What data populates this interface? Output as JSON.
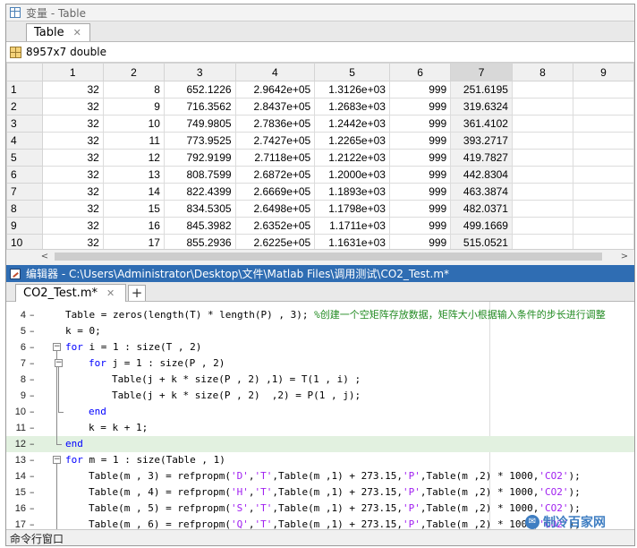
{
  "variables_window": {
    "title": "变量 - Table",
    "tab_label": "Table",
    "close_glyph": "✕",
    "info": "8957x7 double",
    "icons": {
      "window": "variable-window-icon",
      "array": "array-grid-icon"
    }
  },
  "table": {
    "column_headers": [
      "1",
      "2",
      "3",
      "4",
      "5",
      "6",
      "7",
      "8",
      "9"
    ],
    "selected_column": "7",
    "rows": [
      [
        "1",
        "32",
        "8",
        "652.1226",
        "2.9642e+05",
        "1.3126e+03",
        "999",
        "251.6195",
        "",
        ""
      ],
      [
        "2",
        "32",
        "9",
        "716.3562",
        "2.8437e+05",
        "1.2683e+03",
        "999",
        "319.6324",
        "",
        ""
      ],
      [
        "3",
        "32",
        "10",
        "749.9805",
        "2.7836e+05",
        "1.2442e+03",
        "999",
        "361.4102",
        "",
        ""
      ],
      [
        "4",
        "32",
        "11",
        "773.9525",
        "2.7427e+05",
        "1.2265e+03",
        "999",
        "393.2717",
        "",
        ""
      ],
      [
        "5",
        "32",
        "12",
        "792.9199",
        "2.7118e+05",
        "1.2122e+03",
        "999",
        "419.7827",
        "",
        ""
      ],
      [
        "6",
        "32",
        "13",
        "808.7599",
        "2.6872e+05",
        "1.2000e+03",
        "999",
        "442.8304",
        "",
        ""
      ],
      [
        "7",
        "32",
        "14",
        "822.4399",
        "2.6669e+05",
        "1.1893e+03",
        "999",
        "463.3874",
        "",
        ""
      ],
      [
        "8",
        "32",
        "15",
        "834.5305",
        "2.6498e+05",
        "1.1798e+03",
        "999",
        "482.0371",
        "",
        ""
      ],
      [
        "9",
        "32",
        "16",
        "845.3982",
        "2.6352e+05",
        "1.1711e+03",
        "999",
        "499.1669",
        "",
        ""
      ],
      [
        "10",
        "32",
        "17",
        "855.2936",
        "2.6225e+05",
        "1.1631e+03",
        "999",
        "515.0521",
        "",
        ""
      ]
    ],
    "scroll_left": "<",
    "scroll_right": ">"
  },
  "editor_window": {
    "title": "编辑器 - C:\\Users\\Administrator\\Desktop\\文件\\Matlab Files\\调用测试\\CO2_Test.m*",
    "tab_label": "CO2_Test.m*",
    "close_glyph": "✕",
    "add_tab": "+",
    "icons": {
      "window": "editor-window-icon"
    }
  },
  "code_lines": [
    {
      "num": "4",
      "indent": 0,
      "tokens": [
        {
          "t": "Table = zeros(length(T) * length(P) , 3); "
        },
        {
          "t": "%创建一个空矩阵存放数据，矩阵大小根据输入条件的步长进行调整",
          "c": "cmt"
        }
      ]
    },
    {
      "num": "5",
      "indent": 0,
      "tokens": [
        {
          "t": "k = 0;"
        }
      ]
    },
    {
      "num": "6",
      "indent": 0,
      "tokens": [
        {
          "t": "for",
          "c": "kw"
        },
        {
          "t": " i = 1 : size(T , 2)"
        }
      ]
    },
    {
      "num": "7",
      "indent": 1,
      "tokens": [
        {
          "t": "for",
          "c": "kw"
        },
        {
          "t": " j = 1 : size(P , 2)"
        }
      ]
    },
    {
      "num": "8",
      "indent": 2,
      "tokens": [
        {
          "t": "Table(j + k * size(P , 2) ,1) = T(1 , i) ;"
        }
      ]
    },
    {
      "num": "9",
      "indent": 2,
      "tokens": [
        {
          "t": "Table(j + k * size(P , 2)  ,2) = P(1 , j);"
        }
      ]
    },
    {
      "num": "10",
      "indent": 1,
      "tokens": [
        {
          "t": "end",
          "c": "kw"
        }
      ]
    },
    {
      "num": "11",
      "indent": 1,
      "tokens": [
        {
          "t": "k = k + 1;"
        }
      ]
    },
    {
      "num": "12",
      "indent": 0,
      "tokens": [
        {
          "t": "end",
          "c": "kw"
        }
      ]
    },
    {
      "num": "13",
      "indent": 0,
      "tokens": [
        {
          "t": "for",
          "c": "kw"
        },
        {
          "t": " m = 1 : size(Table , 1)"
        }
      ]
    },
    {
      "num": "14",
      "indent": 1,
      "tokens": [
        {
          "t": "Table(m , 3) = refpropm("
        },
        {
          "t": "'D'",
          "c": "str"
        },
        {
          "t": ","
        },
        {
          "t": "'T'",
          "c": "str"
        },
        {
          "t": ",Table(m ,1) + 273.15,"
        },
        {
          "t": "'P'",
          "c": "str"
        },
        {
          "t": ",Table(m ,2) * 1000,"
        },
        {
          "t": "'CO2'",
          "c": "str"
        },
        {
          "t": ");"
        }
      ]
    },
    {
      "num": "15",
      "indent": 1,
      "tokens": [
        {
          "t": "Table(m , 4) = refpropm("
        },
        {
          "t": "'H'",
          "c": "str"
        },
        {
          "t": ","
        },
        {
          "t": "'T'",
          "c": "str"
        },
        {
          "t": ",Table(m ,1) + 273.15,"
        },
        {
          "t": "'P'",
          "c": "str"
        },
        {
          "t": ",Table(m ,2) * 1000,"
        },
        {
          "t": "'CO2'",
          "c": "str"
        },
        {
          "t": ");"
        }
      ]
    },
    {
      "num": "16",
      "indent": 1,
      "tokens": [
        {
          "t": "Table(m , 5) = refpropm("
        },
        {
          "t": "'S'",
          "c": "str"
        },
        {
          "t": ","
        },
        {
          "t": "'T'",
          "c": "str"
        },
        {
          "t": ",Table(m ,1) + 273.15,"
        },
        {
          "t": "'P'",
          "c": "str"
        },
        {
          "t": ",Table(m ,2) * 1000,"
        },
        {
          "t": "'CO2'",
          "c": "str"
        },
        {
          "t": ");"
        }
      ]
    },
    {
      "num": "17",
      "indent": 1,
      "tokens": [
        {
          "t": "Table(m , 6) = refpropm("
        },
        {
          "t": "'Q'",
          "c": "str"
        },
        {
          "t": ","
        },
        {
          "t": "'T'",
          "c": "str"
        },
        {
          "t": ",Table(m ,1) + 273.15,"
        },
        {
          "t": "'P'",
          "c": "str"
        },
        {
          "t": ",Table(m ,2) * 1000,"
        },
        {
          "t": "'CO2'",
          "c": "str"
        },
        {
          "t": ");"
        }
      ]
    }
  ],
  "highlighted_line": "12",
  "status_bar": {
    "text": "命令行窗口"
  },
  "watermark": {
    "text": "制冷百家网",
    "icon": "wechat-icon"
  },
  "colors": {
    "keyword": "#0000ff",
    "string": "#a020f0",
    "comment": "#228b22",
    "editor_titlebar": "#2f6db3",
    "current_line": "#e2f1e0"
  }
}
